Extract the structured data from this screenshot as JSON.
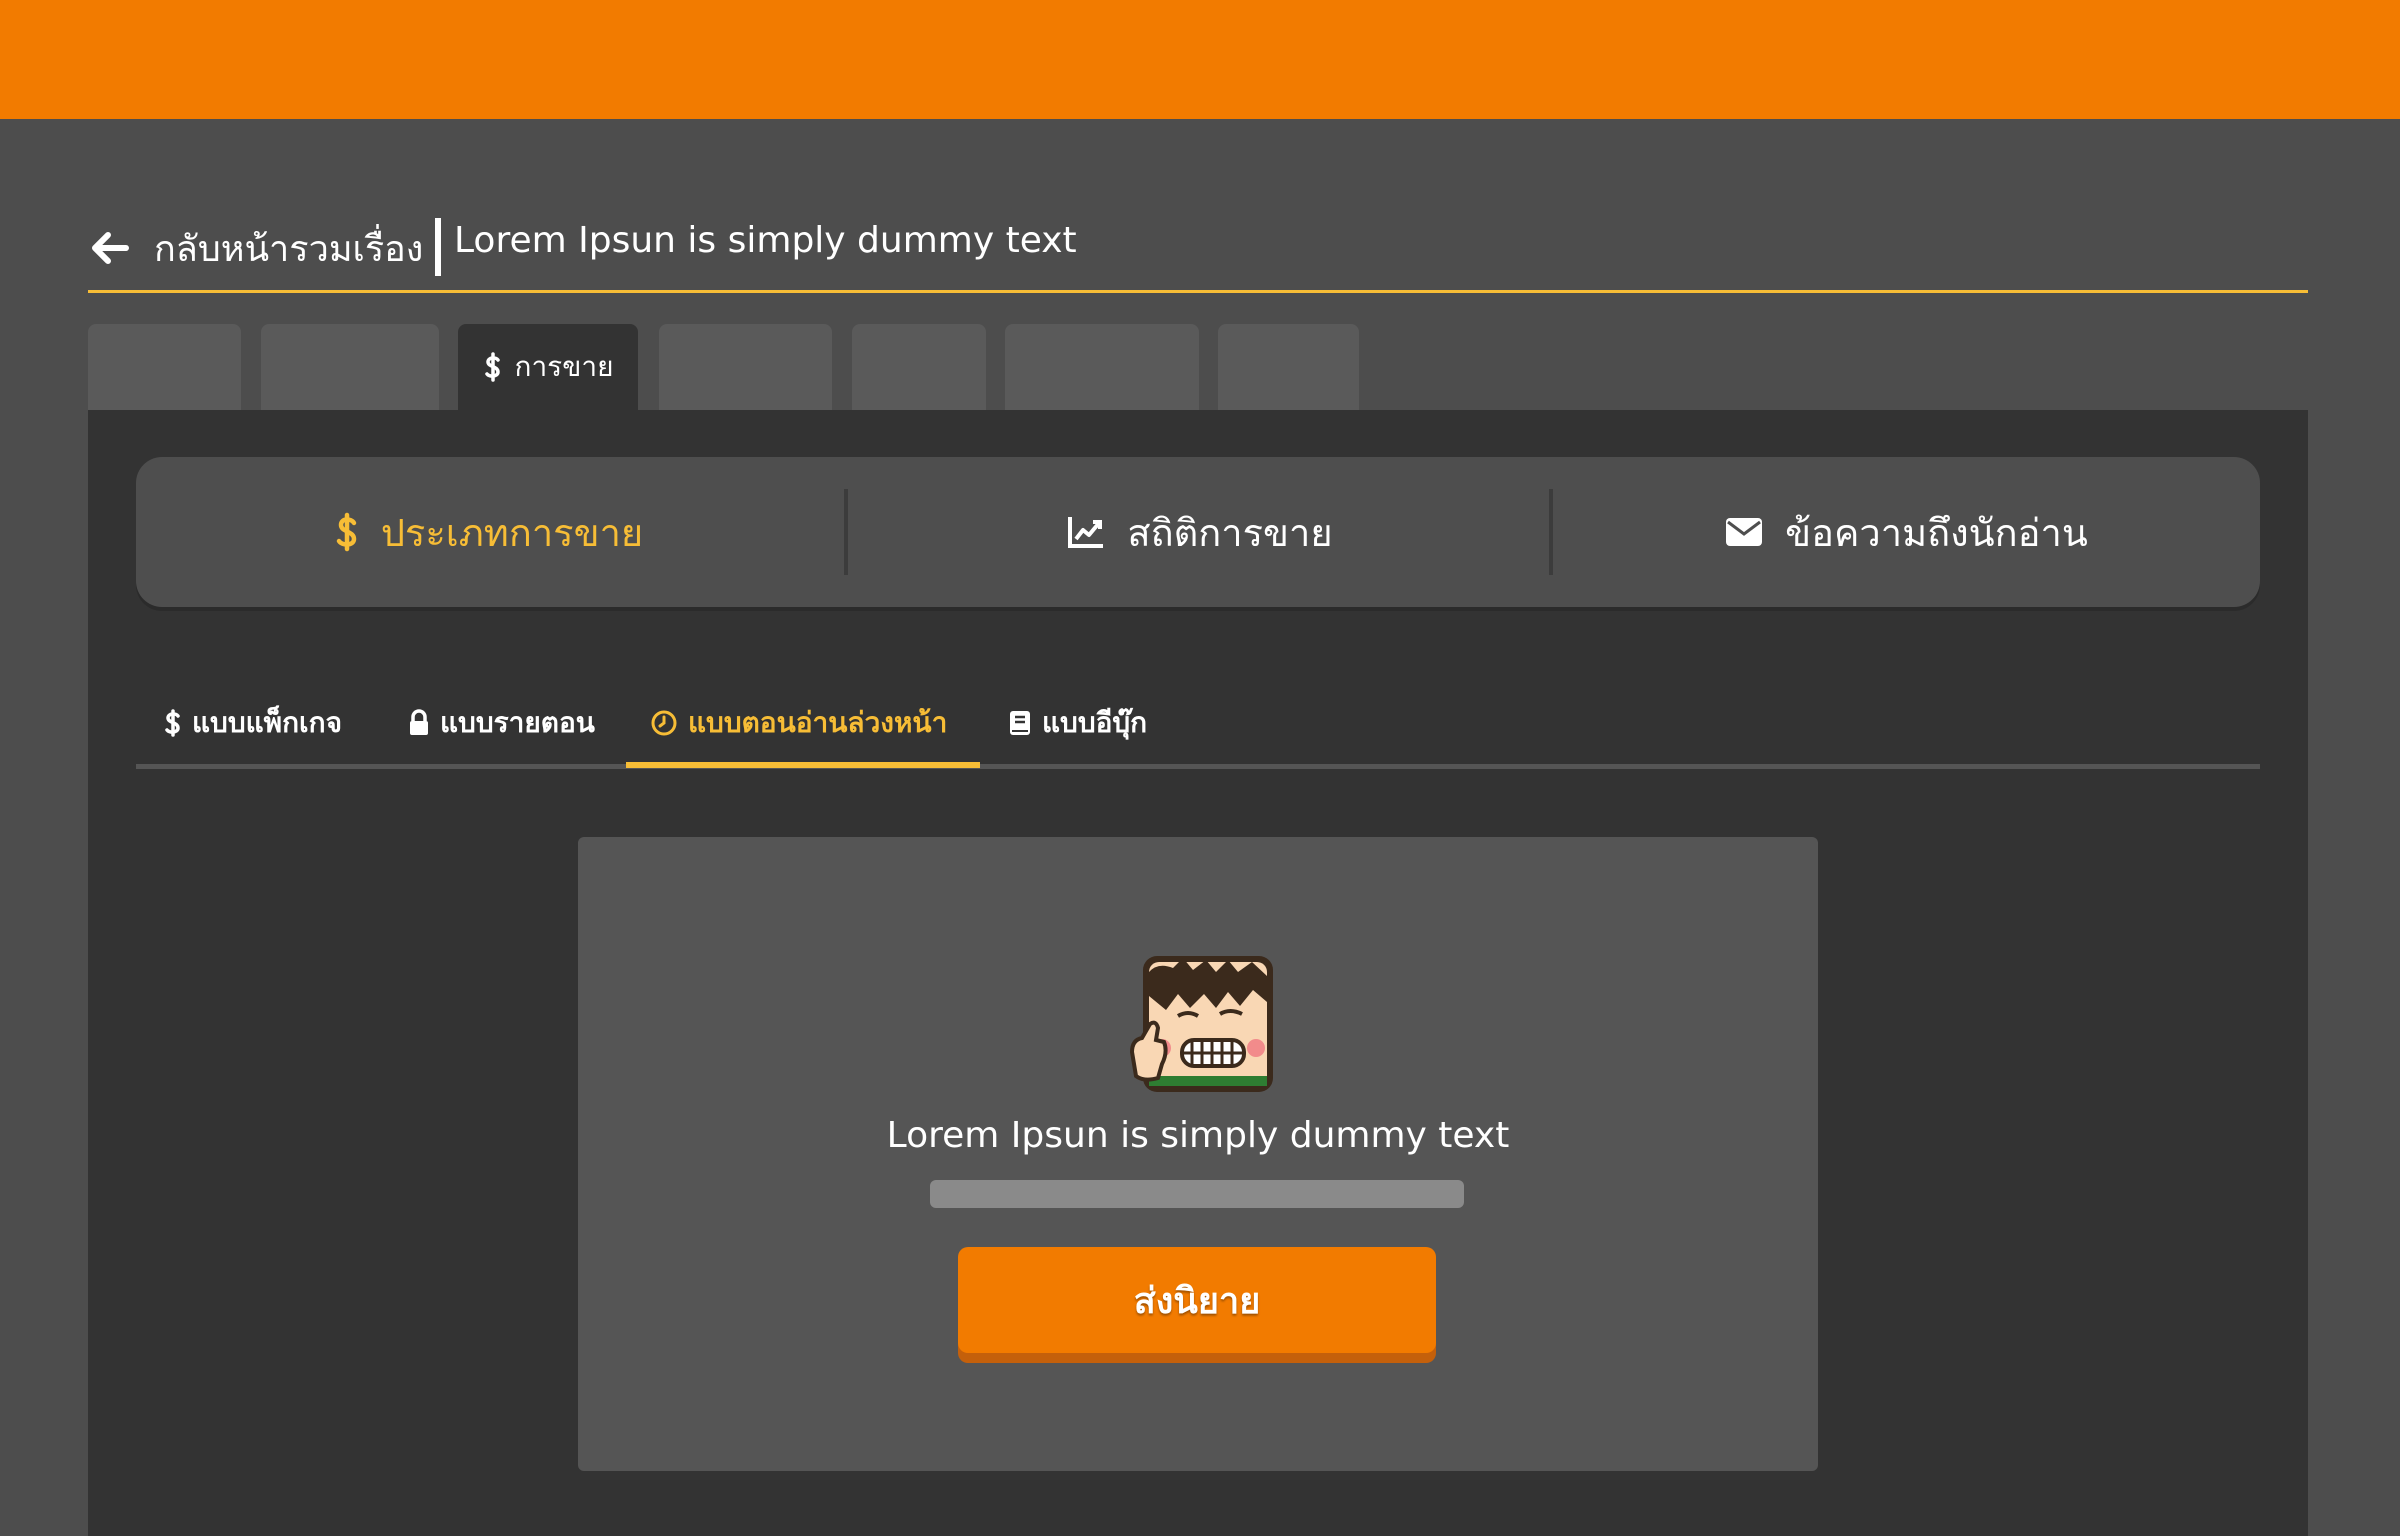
{
  "header": {
    "back_label": "กลับหน้ารวมเรื่อง",
    "story_title": "Lorem Ipsun is simply dummy text"
  },
  "top_tabs": {
    "active_label": "การขาย",
    "active_icon": "dollar-icon"
  },
  "sales_nav": [
    {
      "label": "ประเภทการขาย",
      "icon": "dollar-icon",
      "active": true
    },
    {
      "label": "สถิติการขาย",
      "icon": "chart-line-icon",
      "active": false
    },
    {
      "label": "ข้อความถึงนักอ่าน",
      "icon": "envelope-icon",
      "active": false
    }
  ],
  "sale_type_tabs": [
    {
      "label": "แบบแพ็กเกจ",
      "icon": "dollar-icon",
      "active": false
    },
    {
      "label": "แบบรายตอน",
      "icon": "lock-icon",
      "active": false
    },
    {
      "label": "แบบตอนอ่านล่วงหน้า",
      "icon": "clock-icon",
      "active": true
    },
    {
      "label": "แบบอีบุ๊ก",
      "icon": "book-icon",
      "active": false
    }
  ],
  "card": {
    "mascot_icon": "mascot-thumbs-up",
    "message": "Lorem Ipsun is simply dummy text",
    "submit_label": "ส่งนิยาย"
  },
  "colors": {
    "brand_orange": "#f27b00",
    "accent_yellow": "#f7bd36",
    "page_bg": "#4d4d4d",
    "panel_bg": "#333333"
  }
}
